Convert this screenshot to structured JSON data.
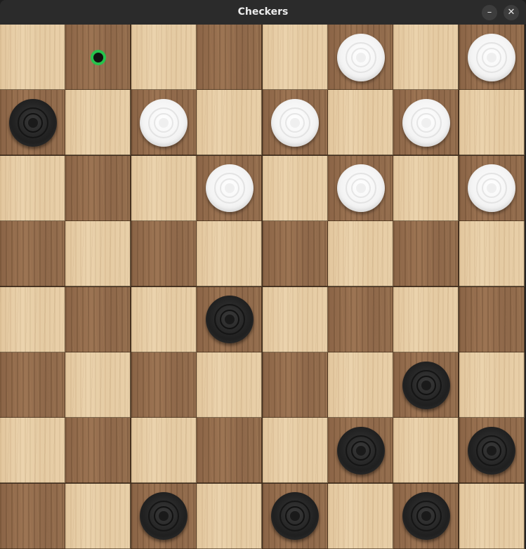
{
  "window": {
    "title": "Checkers",
    "minimize_glyph": "–",
    "close_glyph": "✕"
  },
  "board": {
    "rows": 8,
    "cols": 8,
    "top_left_square": "light",
    "light_square_color": "#e6cca4",
    "dark_square_color": "#93694b",
    "hint_color": "#27c24c",
    "pieces": [
      {
        "row": 0,
        "col": 5,
        "color": "white"
      },
      {
        "row": 0,
        "col": 7,
        "color": "white"
      },
      {
        "row": 1,
        "col": 0,
        "color": "black"
      },
      {
        "row": 1,
        "col": 2,
        "color": "white"
      },
      {
        "row": 1,
        "col": 4,
        "color": "white"
      },
      {
        "row": 1,
        "col": 6,
        "color": "white"
      },
      {
        "row": 2,
        "col": 3,
        "color": "white"
      },
      {
        "row": 2,
        "col": 5,
        "color": "white"
      },
      {
        "row": 2,
        "col": 7,
        "color": "white"
      },
      {
        "row": 4,
        "col": 3,
        "color": "black"
      },
      {
        "row": 5,
        "col": 6,
        "color": "black"
      },
      {
        "row": 6,
        "col": 5,
        "color": "black"
      },
      {
        "row": 6,
        "col": 7,
        "color": "black"
      },
      {
        "row": 7,
        "col": 2,
        "color": "black"
      },
      {
        "row": 7,
        "col": 4,
        "color": "black"
      },
      {
        "row": 7,
        "col": 6,
        "color": "black"
      }
    ],
    "move_hints": [
      {
        "row": 0,
        "col": 1
      }
    ]
  }
}
